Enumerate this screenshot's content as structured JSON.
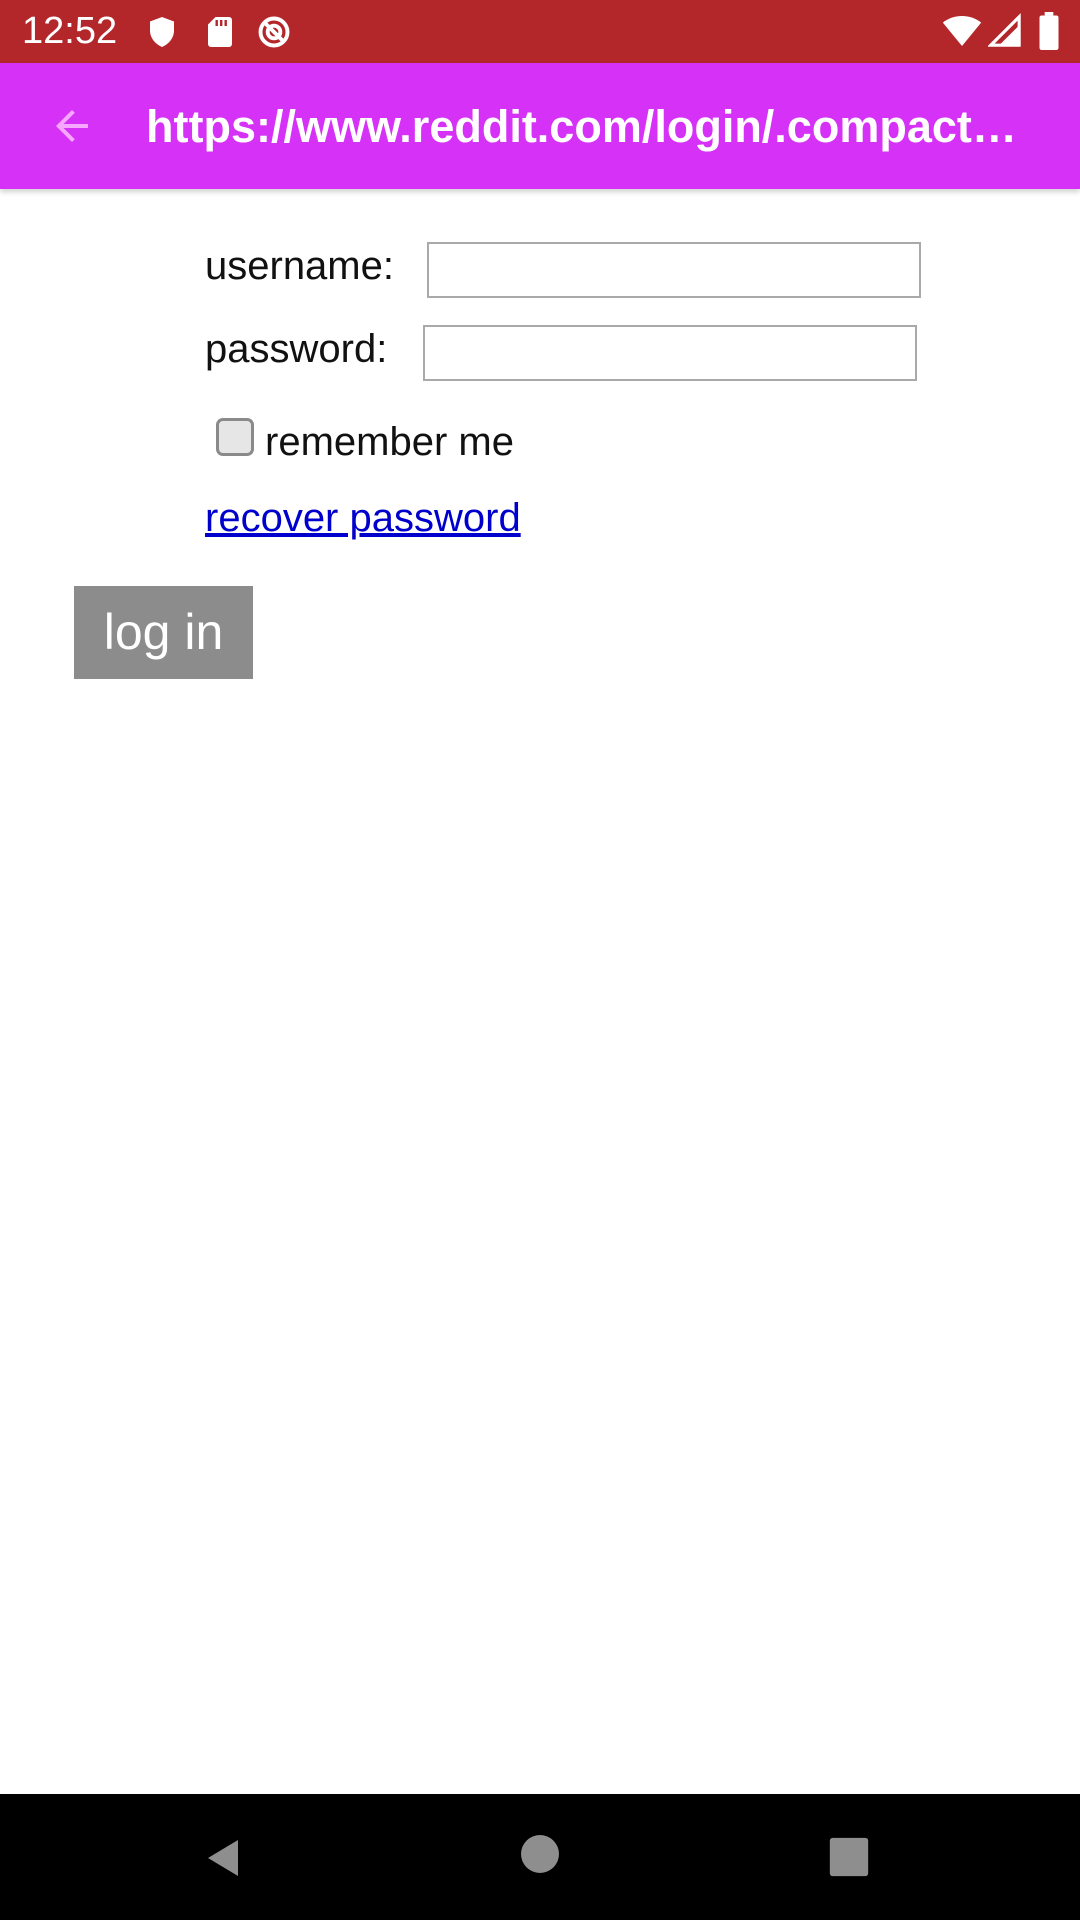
{
  "status_bar": {
    "time": "12:52",
    "icons": [
      "shield-icon",
      "sd-card-icon",
      "data-saver-icon",
      "wifi-icon",
      "signal-icon",
      "battery-icon"
    ],
    "background": "#b3272b"
  },
  "app_bar": {
    "title": "https://www.reddit.com/login/.compact?dest=",
    "back_icon": "arrow-back-icon",
    "background": "#d631f6"
  },
  "form": {
    "username_label": "username:",
    "username_value": "",
    "password_label": "password:",
    "password_value": "",
    "remember_label": "remember me",
    "remember_checked": false,
    "recover_link": "recover password",
    "login_button": "log in",
    "link_color": "#0000cc",
    "button_color": "#8c8c8c"
  },
  "nav_bar": {
    "buttons": [
      "back-triangle-icon",
      "home-circle-icon",
      "recents-square-icon"
    ]
  }
}
